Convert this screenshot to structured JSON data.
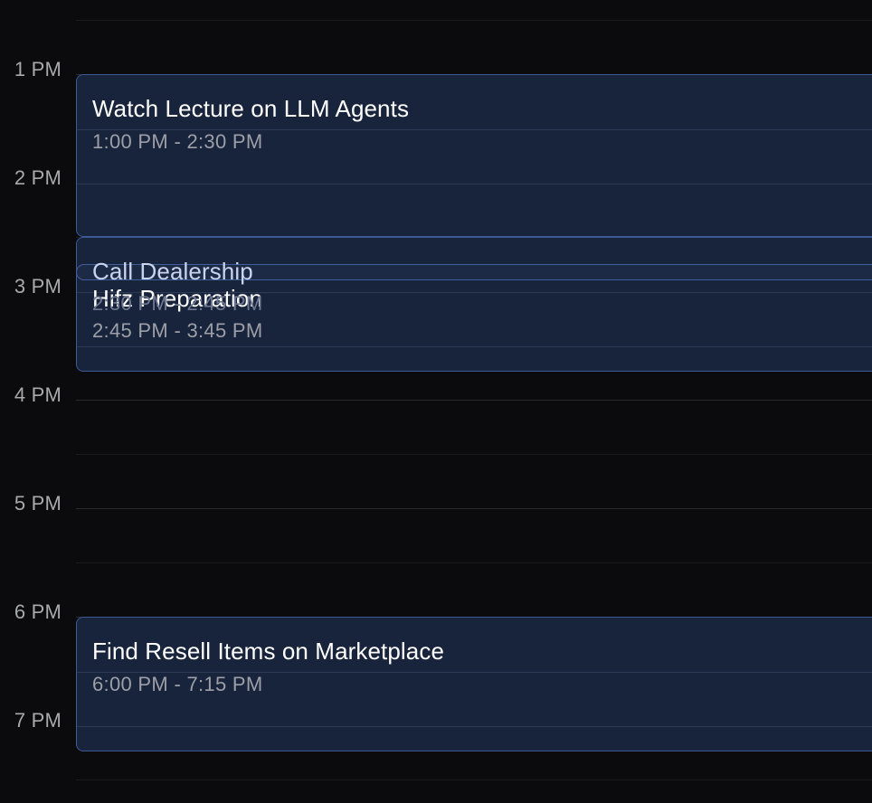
{
  "timeline": {
    "hours": [
      "1 PM",
      "2 PM",
      "3 PM",
      "4 PM",
      "5 PM",
      "6 PM",
      "7 PM"
    ]
  },
  "events": [
    {
      "title": "Watch Lecture on LLM Agents",
      "time": "1:00 PM - 2:30 PM"
    },
    {
      "title": "Call Dealership",
      "time": "2:30 PM - 2:45 PM"
    },
    {
      "title": "Hifz Preparation",
      "time": "2:45 PM - 3:45 PM"
    },
    {
      "title": "Find Resell Items on Marketplace",
      "time": "6:00 PM - 7:15 PM"
    }
  ],
  "colors": {
    "background": "#0b0b0d",
    "event_fill": "#18233c",
    "event_border": "#3e5a96",
    "event_title": "#ffffff",
    "event_time": "#9c9fa6",
    "hour_label": "#a8a9ad"
  }
}
